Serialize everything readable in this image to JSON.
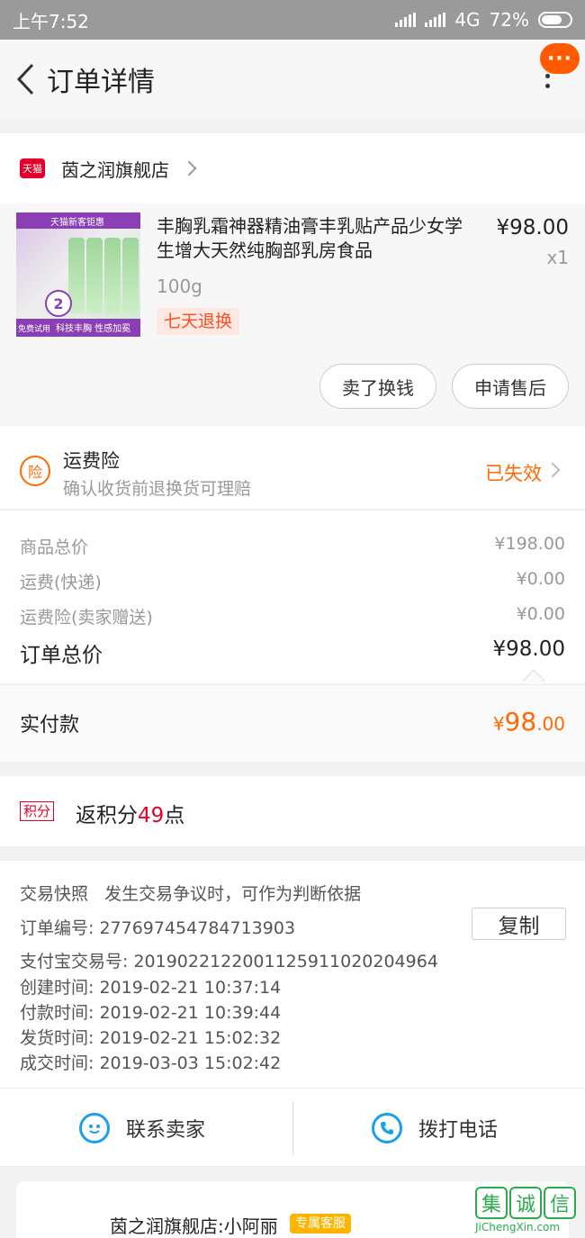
{
  "status_bar": {
    "time": "上午7:52",
    "network": "4G",
    "battery": "72%",
    "battery_level": 0.72
  },
  "nav": {
    "title": "订单详情",
    "more_badge": "···"
  },
  "store": {
    "badge": "天猫",
    "name": "茵之润旗舰店"
  },
  "product": {
    "image_text": {
      "top": "天猫新客钜惠",
      "pack": "2",
      "free_trial": "免费试用",
      "slogan": "科技丰胸 性感加冕"
    },
    "title": "丰胸乳霜神器精油膏丰乳贴产品少女学生增大天然纯胸部乳房食品",
    "price": "¥98.00",
    "quantity": "x1",
    "spec": "100g",
    "tag": "七天退换",
    "buttons": {
      "resell": "卖了换钱",
      "after_sale": "申请售后"
    }
  },
  "insurance": {
    "icon": "险",
    "title": "运费险",
    "subtitle": "确认收货前退换货可理赔",
    "status": "已失效"
  },
  "totals": {
    "rows": [
      {
        "label": "商品总价",
        "value": "¥198.00"
      },
      {
        "label": "运费(快递)",
        "value": "¥0.00"
      },
      {
        "label": "运费险(卖家赠送)",
        "value": "¥0.00"
      }
    ],
    "order_total_label": "订单总价",
    "order_total_value": "¥98.00"
  },
  "paid": {
    "label": "实付款",
    "symbol": "¥",
    "integer": "98",
    "decimal": ".00"
  },
  "points": {
    "tag": "积分",
    "prefix": "返积分",
    "number": "49",
    "suffix": "点"
  },
  "order_info": {
    "snapshot": "交易快照",
    "snapshot_note": "发生交易争议时，可作为判断依据",
    "order_no": "订单编号:   2776974547847139​03",
    "copy_label": "复制",
    "alipay_no": "支付宝交易号:   2019022122001125911020204964",
    "created": "创建时间:   2019-02-21 10:37:14",
    "paid_time": "付款时间:   2019-02-21 10:39:44",
    "shipped": "发货时间:   2019-02-21 15:02:32",
    "completed": "成交时间:   2019-03-03 15:02:42"
  },
  "contact": {
    "seller": "联系卖家",
    "phone": "拨打电话"
  },
  "chat": {
    "name": "茵之润旗舰店:小阿丽",
    "tag": "专属客服"
  },
  "watermark": {
    "chars": [
      "集",
      "诚",
      "信"
    ],
    "url": "JiChengXin.com"
  },
  "colors": {
    "accent": "#ff6a00",
    "tmall": "#e4002b",
    "link_blue": "#1aa0ea"
  }
}
